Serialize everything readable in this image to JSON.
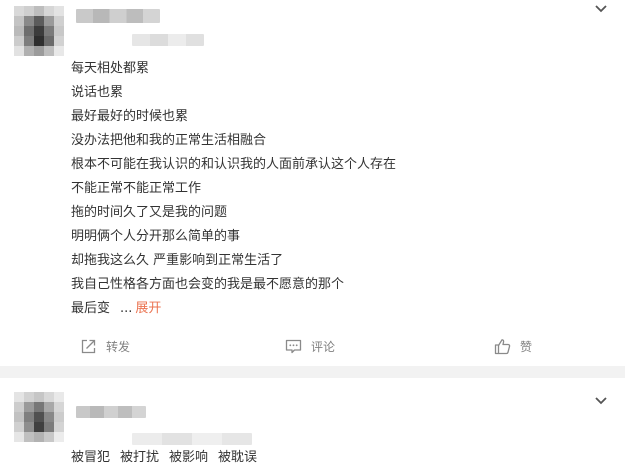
{
  "posts": [
    {
      "lines": [
        "每天相处都累",
        "说话也累",
        "最好最好的时候也累",
        "没办法把他和我的正常生活相融合",
        "根本不可能在我认识的和认识我的人面前承认这个人存在",
        "不能正常不能正常工作",
        "拖的时间久了又是我的问题",
        "明明俩个人分开那么简单的事",
        "却拖我这么久 严重影响到正常生活了",
        "我自己性格各方面也会变的我是最不愿意的那个"
      ],
      "last_line": "最后变",
      "ellipsis": "...",
      "expand_label": "展开",
      "actions": {
        "forward_label": "转发",
        "comment_label": "评论",
        "like_label": "赞"
      }
    },
    {
      "tags": [
        "被冒犯",
        "被打扰",
        "被影响",
        "被耽误"
      ]
    }
  ],
  "icons": {
    "menu": "chevron-down-icon",
    "forward": "forward-icon",
    "comment": "comment-icon",
    "like": "thumbs-up-icon"
  },
  "colors": {
    "expand_link": "#eb7350",
    "action_text": "#808080",
    "separator": "#f2f2f2"
  }
}
